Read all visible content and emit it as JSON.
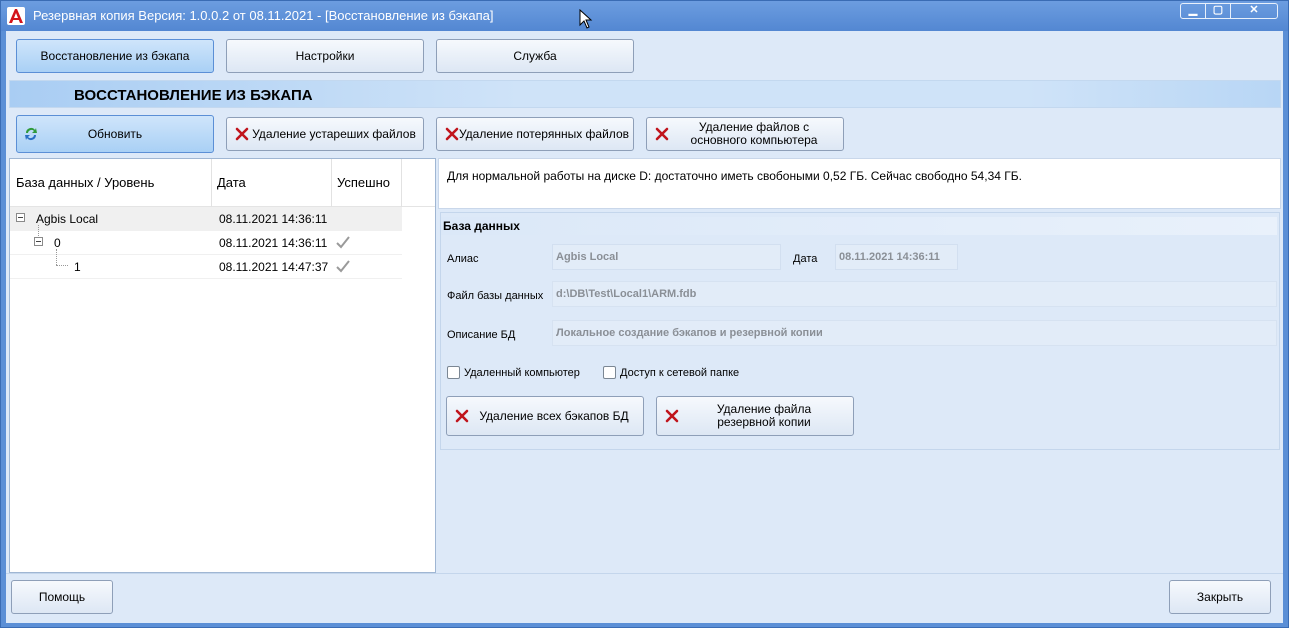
{
  "window": {
    "title": "Резервная копия   Версия: 1.0.0.2 от 08.11.2021 - [Восстановление из бэкапа]",
    "controls": {
      "minimize": "▁",
      "maximize": "▢",
      "close": "✕"
    }
  },
  "tabs": [
    {
      "label": "Восстановление из бэкапа",
      "active": true
    },
    {
      "label": "Настройки",
      "active": false
    },
    {
      "label": "Служба",
      "active": false
    }
  ],
  "section": {
    "title": "ВОССТАНОВЛЕНИЕ ИЗ БЭКАПА"
  },
  "toolbar": {
    "refresh_label": "Обновить",
    "delete_old_label": "Удаление устареших файлов",
    "delete_lost_label": "Удаление потерянных файлов",
    "delete_main_label": "Удаление файлов с основного компьютера"
  },
  "tree": {
    "columns": [
      "База данных / Уровень",
      "Дата",
      "Успешно"
    ],
    "rows": [
      {
        "name": "Agbis Local",
        "date": "08.11.2021 14:36:11",
        "success": false
      },
      {
        "name": "0",
        "date": "08.11.2021 14:36:11",
        "success": true
      },
      {
        "name": "1",
        "date": "08.11.2021 14:47:37",
        "success": true
      }
    ]
  },
  "info": {
    "message": "Для нормальной работы на диске D: достаточно иметь свобоными 0,52 ГБ. Сейчас свободно 54,34 ГБ."
  },
  "database": {
    "group_title": "База данных",
    "alias_label": "Алиас",
    "alias_value": "Agbis Local",
    "date_label": "Дата",
    "date_value": "08.11.2021 14:36:11",
    "file_label": "Файл базы данных",
    "file_value": "d:\\DB\\Test\\Local1\\ARM.fdb",
    "desc_label": "Описание БД",
    "desc_value": "Локальное создание бэкапов и резервной копии",
    "remote_label": "Удаленный компьютер",
    "remote_checked": false,
    "share_label": "Доступ к сетевой папке",
    "share_checked": false,
    "delete_all_label": "Удаление всех бэкапов БД",
    "delete_backup_label": "Удаление файла резервной копии"
  },
  "footer": {
    "help_label": "Помощь",
    "close_label": "Закрыть"
  },
  "colors": {
    "titlebar": "#5b8fd6",
    "client_bg": "#dde9f8",
    "active_tab": "#a9d0f5",
    "delete_icon": "#c0141c"
  }
}
